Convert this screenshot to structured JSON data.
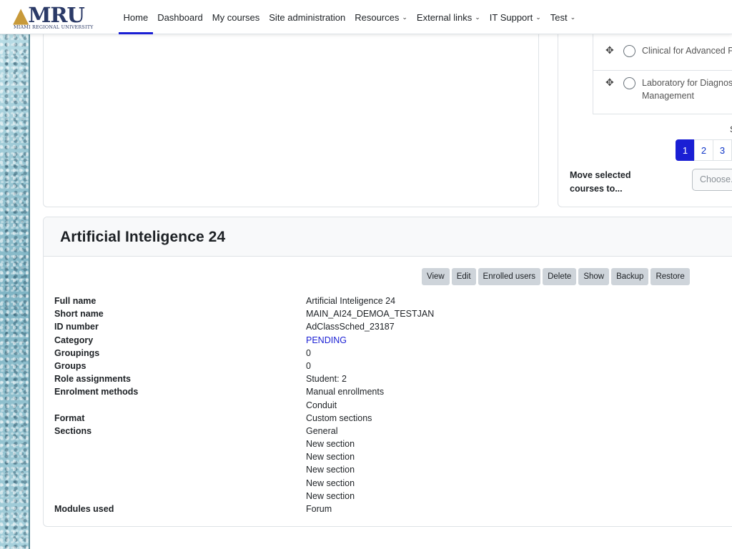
{
  "brand": {
    "logo_text": "MRU",
    "logo_subtitle": "MIAMI REGIONAL UNIVERSITY",
    "accent_gold": "#c89a3a",
    "navy": "#2b3a67"
  },
  "nav": {
    "items": [
      {
        "label": "Home",
        "active": true
      },
      {
        "label": "Dashboard"
      },
      {
        "label": "My courses"
      },
      {
        "label": "Site administration"
      },
      {
        "label": "Resources",
        "dropdown": true
      },
      {
        "label": "External links",
        "dropdown": true
      },
      {
        "label": "IT Support",
        "dropdown": true
      },
      {
        "label": "Test",
        "dropdown": true
      }
    ],
    "active_color": "#1a1fd4"
  },
  "course_list": {
    "items": [
      {
        "name": "Clinical for Advanced Pr"
      },
      {
        "name": "Laboratory for Diagnosi",
        "name_line2": "Management"
      }
    ],
    "page_prefix": "S",
    "pages": [
      "1",
      "2",
      "3"
    ],
    "current_page": "1",
    "move_label_1": "Move selected",
    "move_label_2": "courses to...",
    "choose_placeholder": "Choose..."
  },
  "course": {
    "title": "Artificial Inteligence 24",
    "actions": [
      "View",
      "Edit",
      "Enrolled users",
      "Delete",
      "Show",
      "Backup",
      "Restore"
    ],
    "details": [
      {
        "label": "Full name",
        "value": "Artificial Inteligence 24"
      },
      {
        "label": "Short name",
        "value": "MAIN_AI24_DEMOA_TESTJAN"
      },
      {
        "label": "ID number",
        "value": "AdClassSched_23187"
      },
      {
        "label": "Category",
        "value": "PENDING",
        "link": true
      },
      {
        "label": "Groupings",
        "value": "0"
      },
      {
        "label": "Groups",
        "value": "0"
      },
      {
        "label": "Role assignments",
        "value": "Student: 2"
      },
      {
        "label": "Enrolment methods",
        "value": "Manual enrollments"
      },
      {
        "label": "",
        "value": "Conduit"
      },
      {
        "label": "Format",
        "value": "Custom sections"
      },
      {
        "label": "Sections",
        "value": "General"
      },
      {
        "label": "",
        "value": "New section"
      },
      {
        "label": "",
        "value": "New section"
      },
      {
        "label": "",
        "value": "New section"
      },
      {
        "label": "",
        "value": "New section"
      },
      {
        "label": "",
        "value": "New section"
      },
      {
        "label": "Modules used",
        "value": "Forum"
      }
    ]
  }
}
